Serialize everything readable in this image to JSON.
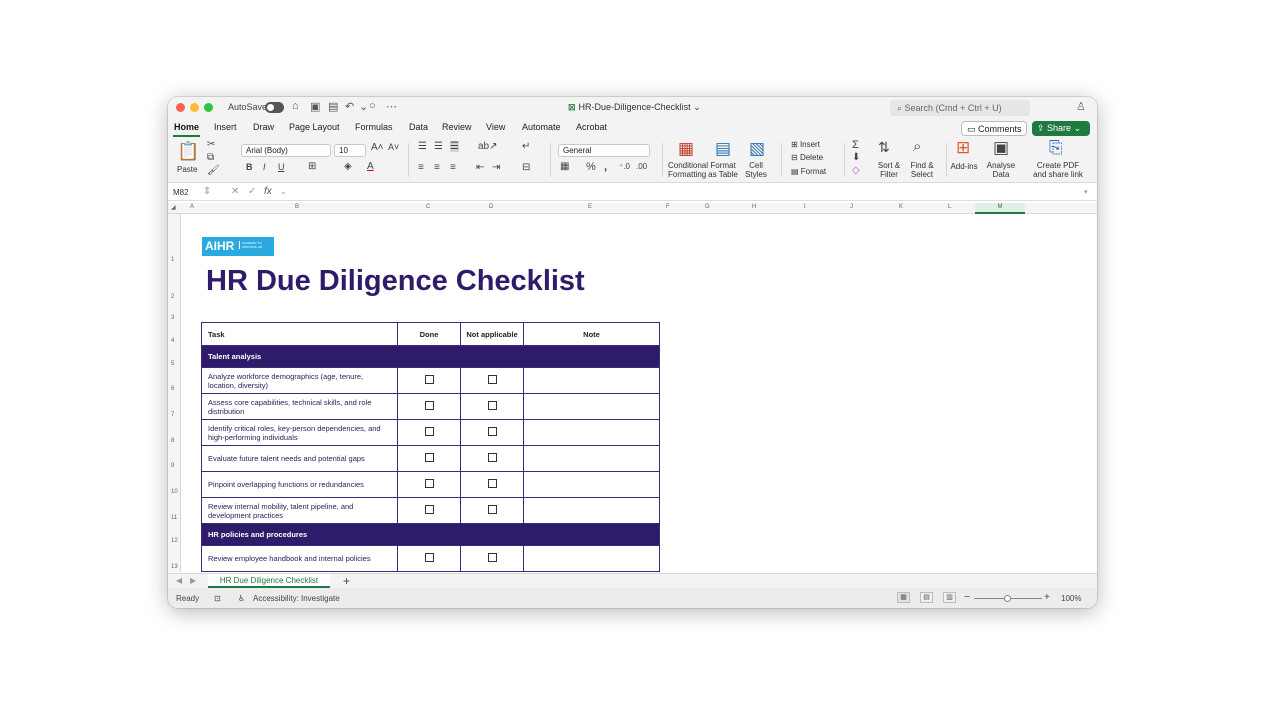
{
  "window": {
    "autosave_label": "AutoSave",
    "doc_title": "HR-Due-Diligence-Checklist",
    "search_placeholder": "Search (Cmd + Ctrl + U)"
  },
  "tabs": [
    "Home",
    "Insert",
    "Draw",
    "Page Layout",
    "Formulas",
    "Data",
    "Review",
    "View",
    "Automate",
    "Acrobat"
  ],
  "buttons": {
    "comments": "Comments",
    "share": "Share"
  },
  "ribbon": {
    "paste": "Paste",
    "font_name": "Arial (Body)",
    "font_size": "10",
    "number_format": "General",
    "conditional_formatting": "Conditional Formatting",
    "format_as_table": "Format as Table",
    "cell_styles": "Cell Styles",
    "insert": "Insert",
    "delete": "Delete",
    "format": "Format",
    "sort_filter": "Sort & Filter",
    "find_select": "Find & Select",
    "addins": "Add-ins",
    "analyse_data": "Analyse Data",
    "create_pdf": "Create PDF and share link"
  },
  "formula_bar": {
    "cell_ref": "M82",
    "fx": "fx"
  },
  "columns": [
    "A",
    "B",
    "C",
    "D",
    "E",
    "F",
    "G",
    "H",
    "I",
    "J",
    "K",
    "L",
    "M"
  ],
  "rows": [
    "1",
    "2",
    "3",
    "4",
    "5",
    "6",
    "7",
    "8",
    "9",
    "10",
    "11",
    "12",
    "13"
  ],
  "sheet": {
    "logo_text": "AIHR",
    "logo_sub": "ACADEMY TO INNOVATE HR",
    "title": "HR Due Diligence Checklist",
    "headers": {
      "task": "Task",
      "done": "Done",
      "na": "Not applicable",
      "note": "Note"
    },
    "section1": "Talent analysis",
    "items1": [
      "Analyze workforce demographics (age, tenure, location, diversity)",
      "Assess core capabilities, technical skills, and role distribution",
      "Identify critical roles, key-person dependencies, and high-performing individuals",
      "Evaluate future talent needs and potential gaps",
      "Pinpoint overlapping functions or redundancies",
      "Review internal mobility, talent pipeline, and development practices"
    ],
    "section2": "HR policies and procedures",
    "items2": [
      "Review employee handbook and internal policies"
    ]
  },
  "sheet_tab": "HR Due Diligence Checklist",
  "status": {
    "ready": "Ready",
    "accessibility": "Accessibility: Investigate",
    "zoom": "100%"
  }
}
